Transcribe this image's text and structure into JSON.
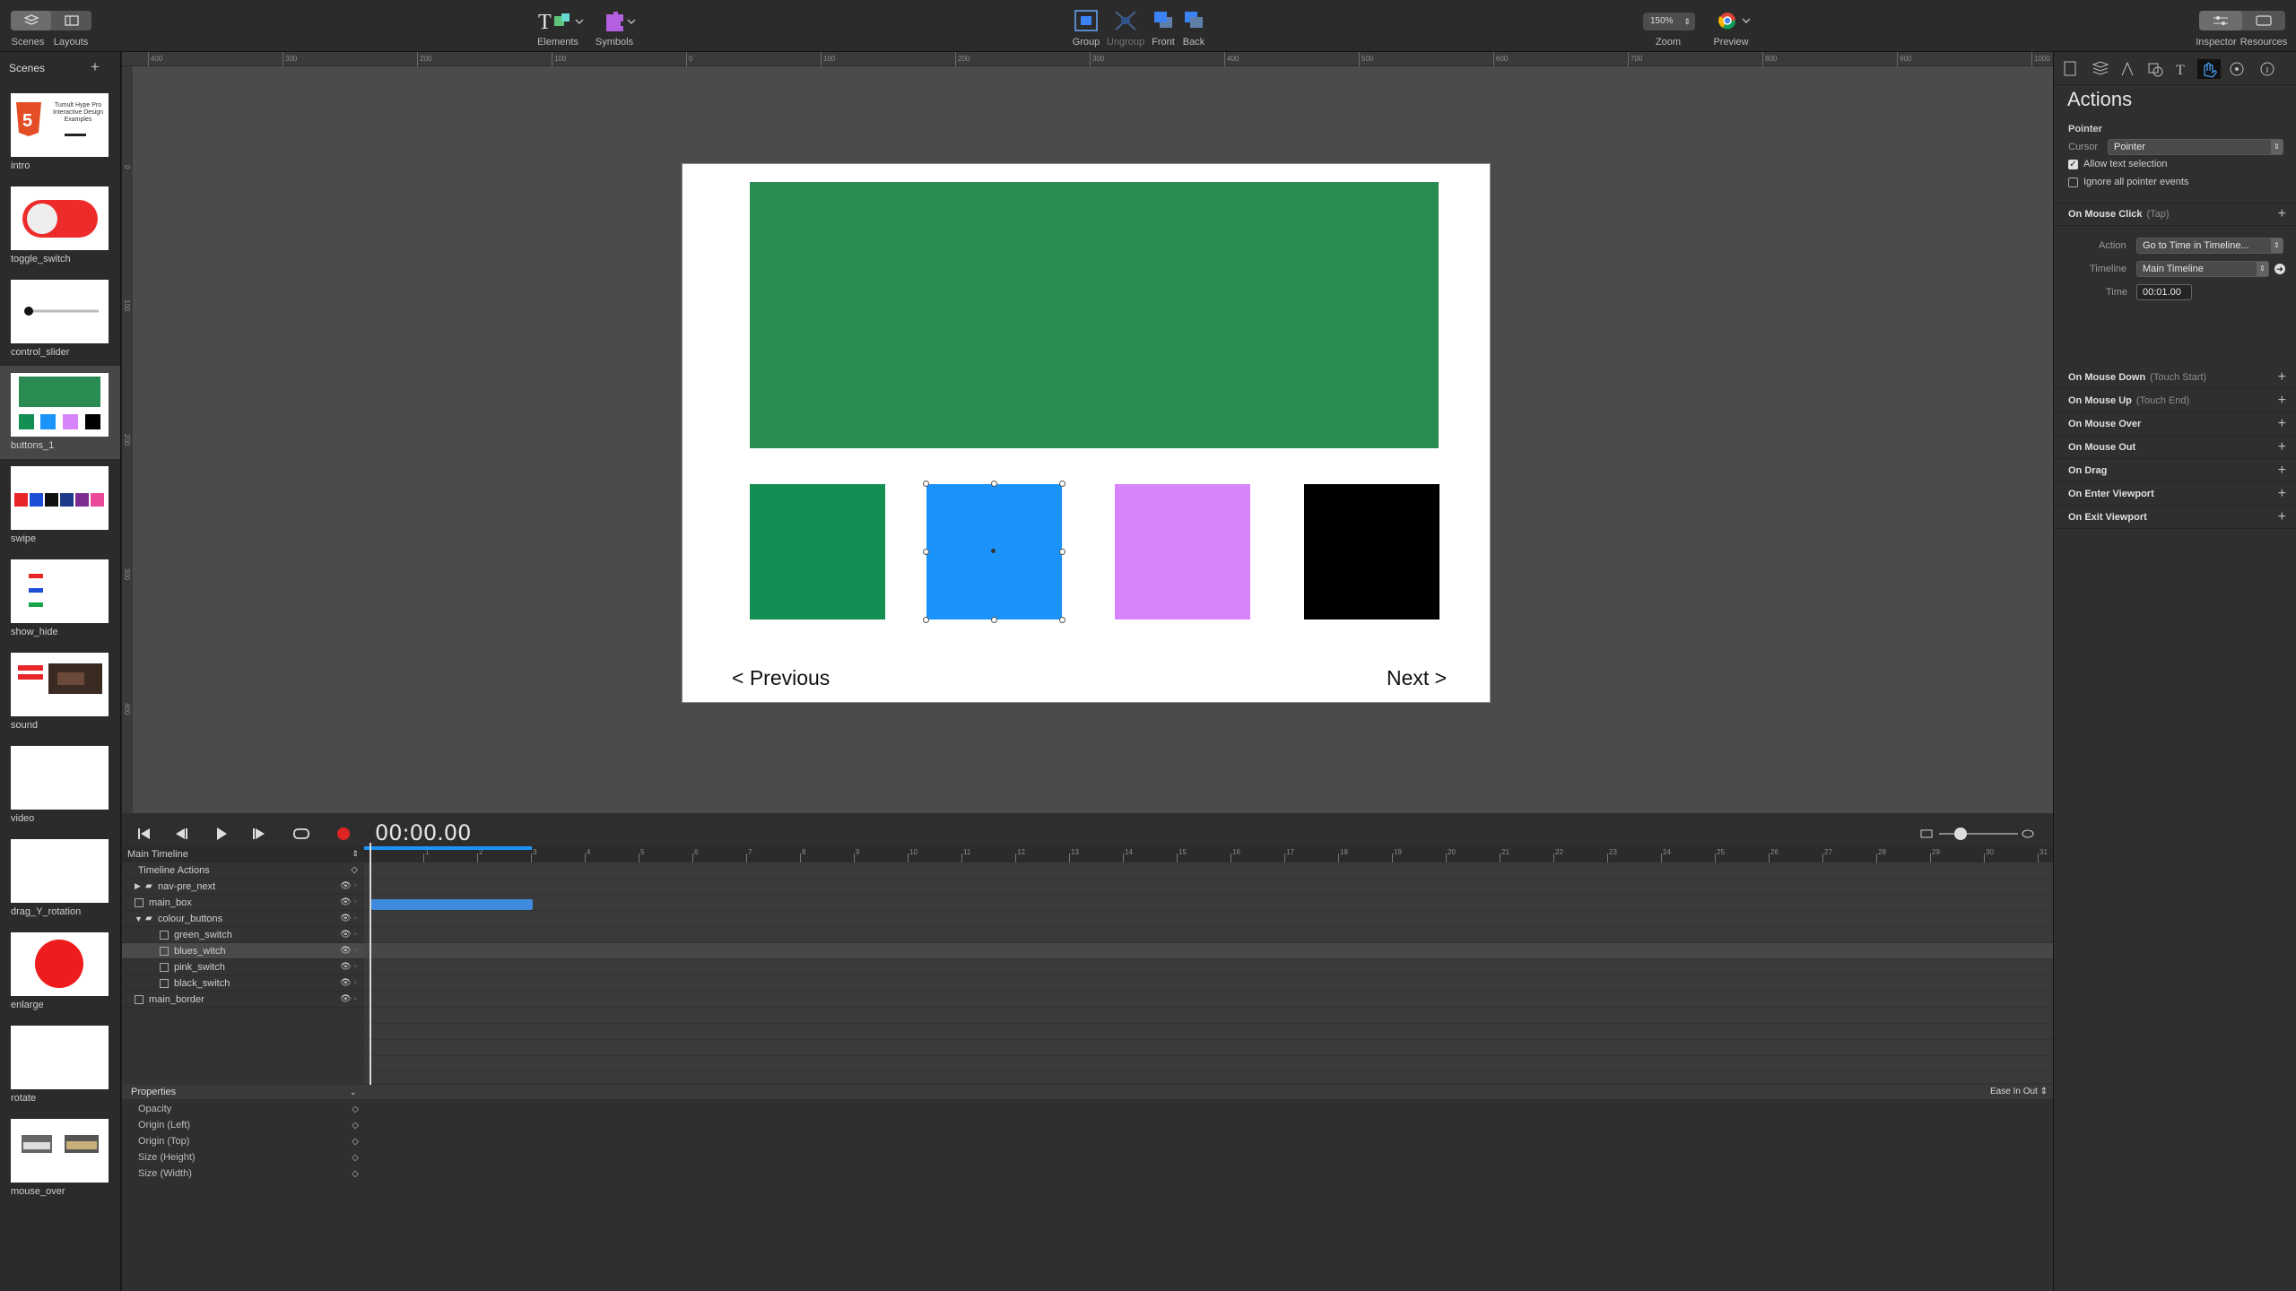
{
  "toolbar": {
    "scenes_label": "Scenes",
    "layouts_label": "Layouts",
    "elements_label": "Elements",
    "symbols_label": "Symbols",
    "group_label": "Group",
    "ungroup_label": "Ungroup",
    "front_label": "Front",
    "back_label": "Back",
    "zoom_value": "150%",
    "zoom_label": "Zoom",
    "preview_label": "Preview",
    "inspector_label": "Inspector",
    "resources_label": "Resources"
  },
  "scenes": {
    "title": "Scenes",
    "add": "+",
    "items": [
      {
        "label": "intro"
      },
      {
        "label": "toggle_switch"
      },
      {
        "label": "control_slider"
      },
      {
        "label": "buttons_1"
      },
      {
        "label": "swipe"
      },
      {
        "label": "show_hide"
      },
      {
        "label": "sound"
      },
      {
        "label": "video"
      },
      {
        "label": "drag_Y_rotation"
      },
      {
        "label": "enlarge"
      },
      {
        "label": "rotate"
      },
      {
        "label": "mouse_over"
      }
    ],
    "selected": "buttons_1",
    "intro_thumb_text": "Tumult Hype Pro Interactive Design Examples"
  },
  "ruler": {
    "h_ticks": [
      "400",
      "300",
      "200",
      "100",
      "0",
      "100",
      "200",
      "300",
      "400",
      "500",
      "600",
      "700",
      "800",
      "900",
      "1000"
    ],
    "v_ticks": [
      "0",
      "100",
      "200",
      "300",
      "400"
    ]
  },
  "stage": {
    "prev_label": "< Previous",
    "next_label": "Next >",
    "colors": {
      "main_box": "#2a8c53",
      "green_switch": "#148f54",
      "blue_switch": "#1a94fb",
      "pink_switch": "#d784fa",
      "black_switch": "#000000"
    }
  },
  "timeline": {
    "time": "00:00.00",
    "name": "Main Timeline",
    "ticks": [
      "1",
      "2",
      "3",
      "4",
      "5",
      "6",
      "7",
      "8",
      "9",
      "10",
      "11",
      "12",
      "13",
      "14",
      "15",
      "16",
      "17",
      "18",
      "19",
      "20",
      "21",
      "22",
      "23",
      "24",
      "25",
      "26",
      "27",
      "28",
      "29",
      "30",
      "31"
    ],
    "layers": [
      {
        "label": "Timeline Actions",
        "indent": 0,
        "type": "header"
      },
      {
        "label": "nav-pre_next",
        "indent": 1,
        "type": "group-collapsed"
      },
      {
        "label": "main_box",
        "indent": 1,
        "type": "element"
      },
      {
        "label": "colour_buttons",
        "indent": 1,
        "type": "group-open"
      },
      {
        "label": "green_switch",
        "indent": 2,
        "type": "element"
      },
      {
        "label": "blues_witch",
        "indent": 2,
        "type": "element",
        "selected": true
      },
      {
        "label": "pink_switch",
        "indent": 2,
        "type": "element"
      },
      {
        "label": "black_switch",
        "indent": 2,
        "type": "element"
      },
      {
        "label": "main_border",
        "indent": 1,
        "type": "element"
      }
    ],
    "properties_label": "Properties",
    "easing": "Ease In Out",
    "properties": [
      "Opacity",
      "Origin (Left)",
      "Origin (Top)",
      "Size (Height)",
      "Size (Width)"
    ]
  },
  "inspector": {
    "title": "Actions",
    "pointer_section": "Pointer",
    "cursor_label": "Cursor",
    "cursor_value": "Pointer",
    "allow_text_selection": "Allow text selection",
    "allow_text_selection_checked": true,
    "ignore_pointer": "Ignore all pointer events",
    "ignore_pointer_checked": false,
    "mouse_click": {
      "label": "On Mouse Click",
      "sub": "(Tap)"
    },
    "action_label": "Action",
    "action_value": "Go to Time in Timeline...",
    "timeline_label": "Timeline",
    "timeline_value": "Main Timeline",
    "time_label": "Time",
    "time_value": "00:01.00",
    "events": [
      {
        "label": "On Mouse Down",
        "sub": "(Touch Start)"
      },
      {
        "label": "On Mouse Up",
        "sub": "(Touch End)"
      },
      {
        "label": "On Mouse Over",
        "sub": ""
      },
      {
        "label": "On Mouse Out",
        "sub": ""
      },
      {
        "label": "On Drag",
        "sub": ""
      },
      {
        "label": "On Enter Viewport",
        "sub": ""
      },
      {
        "label": "On Exit Viewport",
        "sub": ""
      }
    ]
  }
}
